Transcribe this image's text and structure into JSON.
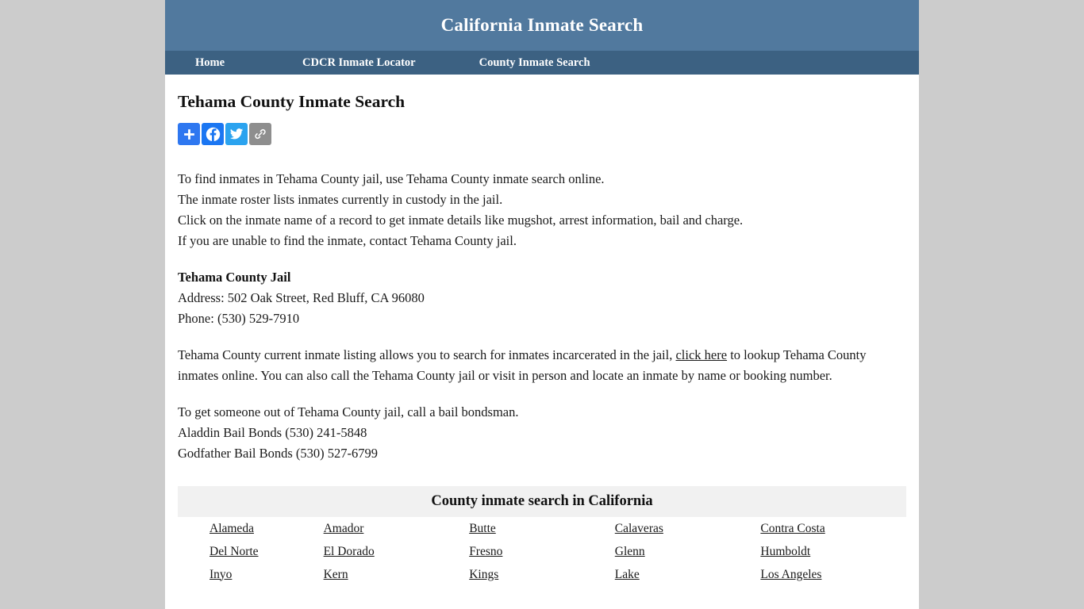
{
  "site": {
    "title": "California Inmate Search",
    "header_bg": "#51799e",
    "nav_bg": "#3c6182",
    "page_bg": "#cccccc"
  },
  "nav": {
    "items": [
      {
        "label": "Home"
      },
      {
        "label": "CDCR Inmate Locator"
      },
      {
        "label": "County Inmate Search"
      }
    ]
  },
  "main": {
    "page_title": "Tehama County Inmate Search",
    "share": {
      "buttons": [
        {
          "name": "addthis-share-button",
          "icon": "plus-icon",
          "color": "#2e77f0"
        },
        {
          "name": "facebook-share-button",
          "icon": "facebook-icon",
          "color": "#1b76f2"
        },
        {
          "name": "twitter-share-button",
          "icon": "twitter-bird-icon",
          "color": "#2ba3ef"
        },
        {
          "name": "copy-link-button",
          "icon": "chain-link-icon",
          "color": "#8e8e8e"
        }
      ]
    },
    "intro_lines": [
      "To find inmates in Tehama County jail, use Tehama County inmate search online.",
      "The inmate roster lists inmates currently in custody in the jail.",
      "Click on the inmate name of a record to get inmate details like mugshot, arrest information, bail and charge.",
      "If you are unable to find the inmate, contact Tehama County jail."
    ],
    "jail": {
      "name": "Tehama County Jail",
      "address": "Address: 502 Oak Street, Red Bluff, CA 96080",
      "phone": "Phone: (530) 529-7910"
    },
    "listing_paragraph": {
      "before_link": "Tehama County current inmate listing allows you to search for inmates incarcerated in the jail, ",
      "link_text": "click here",
      "after_link": " to lookup Tehama County inmates online. You can also call the Tehama County jail or visit in person and locate an inmate by name or booking number."
    },
    "bail": {
      "intro": "To get someone out of Tehama County jail, call a bail bondsman.",
      "bondsmen": [
        "Aladdin Bail Bonds (530) 241-5848",
        "Godfather Bail Bonds (530) 527-6799"
      ]
    },
    "county_table": {
      "caption": "County inmate search in California",
      "rows": [
        [
          "Alameda",
          "Amador",
          "Butte",
          "Calaveras",
          "Contra Costa"
        ],
        [
          "Del Norte",
          "El Dorado",
          "Fresno",
          "Glenn",
          "Humboldt"
        ],
        [
          "Inyo",
          "Kern",
          "Kings",
          "Lake",
          "Los Angeles"
        ]
      ]
    }
  }
}
